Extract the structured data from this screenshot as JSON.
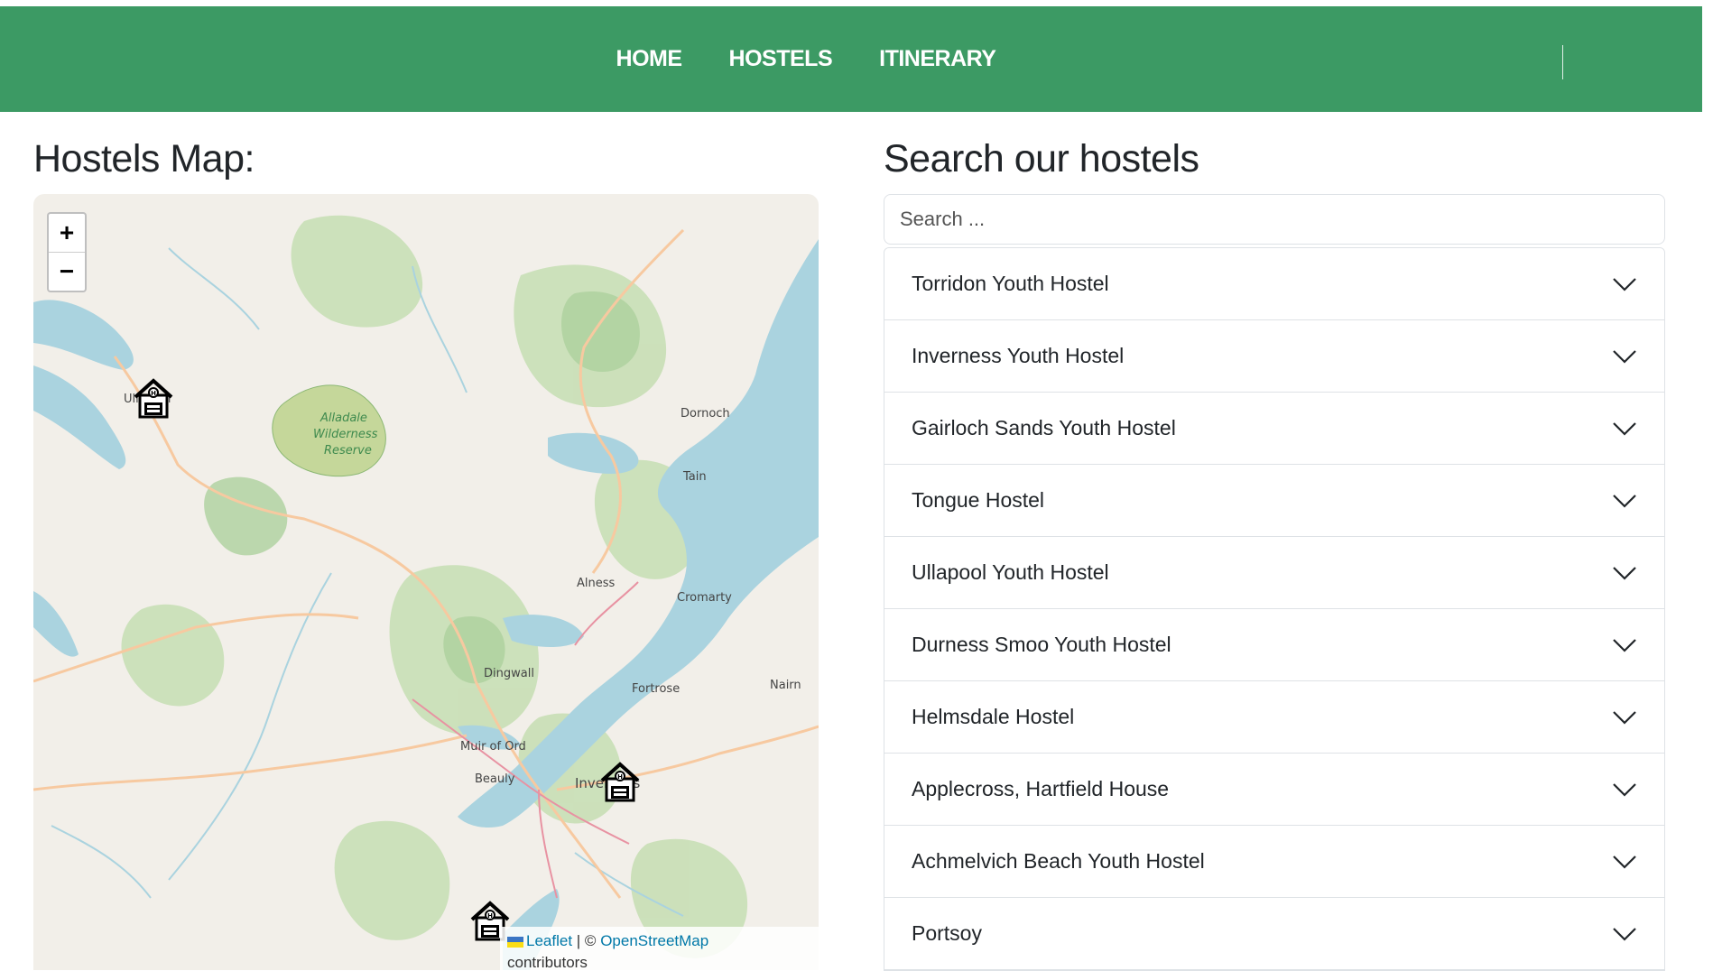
{
  "nav": {
    "links": [
      "HOME",
      "HOSTELS",
      "ITINERARY"
    ]
  },
  "map_section": {
    "title": "Hostels Map:",
    "zoom_in": "+",
    "zoom_out": "−",
    "attribution": {
      "leaflet": "Leaflet",
      "separator": "| ©",
      "osm": "OpenStreetMap",
      "contributors": "contributors"
    },
    "labels": [
      "Alladale",
      "Wilderness",
      "Reserve",
      "Dornoch",
      "Tain",
      "Alness",
      "Cromarty",
      "Dingwall",
      "Fortrose",
      "Nairn",
      "Muir of Ord",
      "Beauly",
      "Inverness",
      "Ullapool"
    ]
  },
  "search_section": {
    "title": "Search our hostels",
    "placeholder": "Search ...",
    "hostels": [
      "Torridon Youth Hostel",
      "Inverness Youth Hostel",
      "Gairloch Sands Youth Hostel",
      "Tongue Hostel",
      "Ullapool Youth Hostel",
      "Durness Smoo Youth Hostel",
      "Helmsdale Hostel",
      "Applecross, Hartfield House",
      "Achmelvich Beach Youth Hostel",
      "Portsoy"
    ]
  },
  "colors": {
    "navbar": "#3c9a64",
    "water": "#aad3df",
    "land": "#f2efe9",
    "forest": "#add19e"
  }
}
